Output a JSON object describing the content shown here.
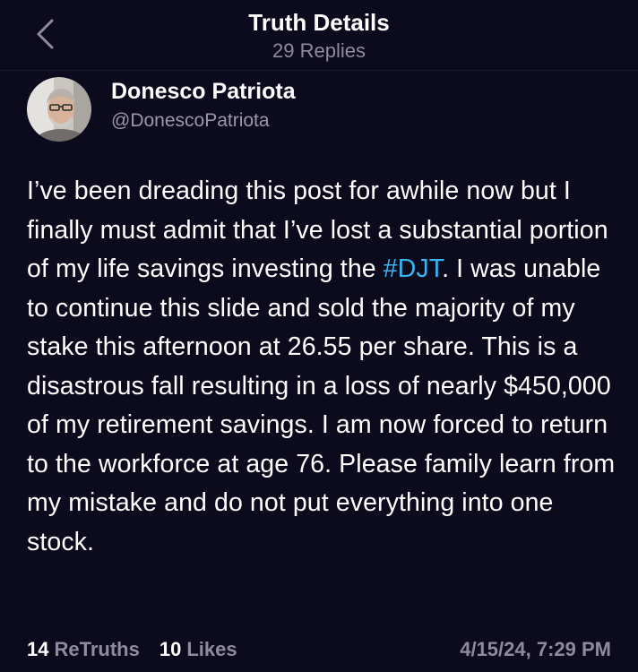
{
  "header": {
    "title": "Truth Details",
    "subtitle": "29 Replies",
    "back_icon": "chevron-left-icon"
  },
  "author": {
    "name": "Donesco Patriota",
    "handle": "@DonescoPatriota"
  },
  "post": {
    "text_before": "I’ve been dreading this post for awhile now but I finally must admit that I’ve lost a substantial portion of my life savings investing the ",
    "hashtag": "#DJT",
    "text_after": ". I was unable to continue this slide and sold the majority of my stake this afternoon at 26.55 per share. This is a disastrous fall resulting in a loss of nearly $450,000 of my retirement savings. I am now forced to return to the workforce at age 76. Please family learn from my mistake and do not put everything into one stock."
  },
  "stats": {
    "retruths_count": "14",
    "retruths_label": "ReTruths",
    "likes_count": "10",
    "likes_label": "Likes",
    "timestamp": "4/15/24, 7:29 PM"
  },
  "colors": {
    "background": "#0c0a1d",
    "hashtag": "#38b6f3",
    "muted": "#8e8c9c"
  }
}
